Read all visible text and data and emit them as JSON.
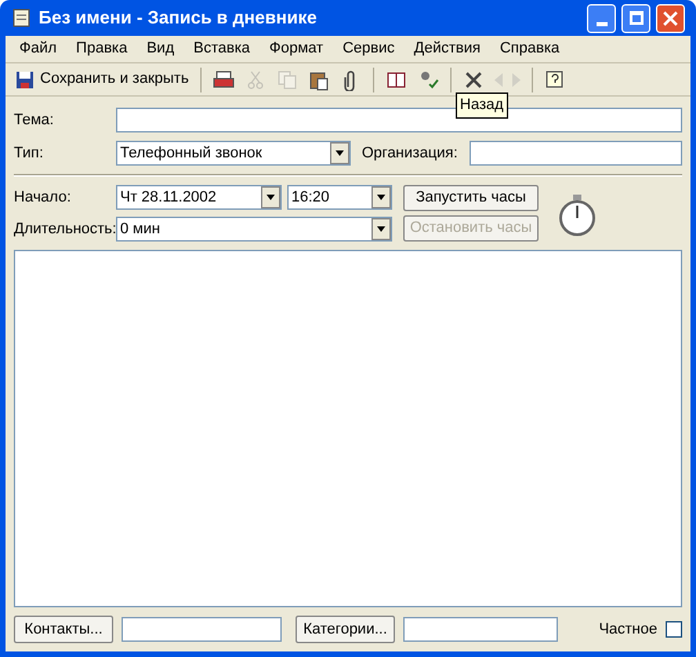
{
  "window": {
    "title": "Без имени - Запись в дневнике"
  },
  "menu": [
    "Файл",
    "Правка",
    "Вид",
    "Вставка",
    "Формат",
    "Сервис",
    "Действия",
    "Справка"
  ],
  "toolbar": [
    {
      "kind": "save",
      "label": "Сохранить и закрыть",
      "disabled": false
    },
    {
      "kind": "print",
      "disabled": false
    },
    {
      "kind": "cut",
      "disabled": true
    },
    {
      "kind": "copy",
      "disabled": true
    },
    {
      "kind": "paste",
      "disabled": false
    },
    {
      "kind": "attach",
      "disabled": false
    },
    {
      "kind": "addressbook",
      "disabled": false
    },
    {
      "kind": "checknames",
      "disabled": false
    },
    {
      "kind": "delete",
      "disabled": false
    },
    {
      "kind": "back",
      "disabled": true
    },
    {
      "kind": "forward",
      "disabled": true
    },
    {
      "kind": "help",
      "disabled": false
    }
  ],
  "tooltip": "Назад",
  "subject": {
    "label": "Тема:"
  },
  "type": {
    "label": "Тип:",
    "value": "Телефонный звонок"
  },
  "company": {
    "label": "Организация:"
  },
  "start": {
    "label": "Начало:",
    "date": "Чт 28.11.2002",
    "time": "16:20"
  },
  "duration": {
    "label": "Длительность:",
    "value": "0 мин"
  },
  "timer_buttons": [
    {
      "label": "Запустить часы",
      "disabled": false
    },
    {
      "label": "Остановить часы",
      "disabled": true
    }
  ],
  "contacts_button": "Контакты...",
  "categories_button": "Категории...",
  "private": {
    "label": "Частное",
    "checked": false
  }
}
